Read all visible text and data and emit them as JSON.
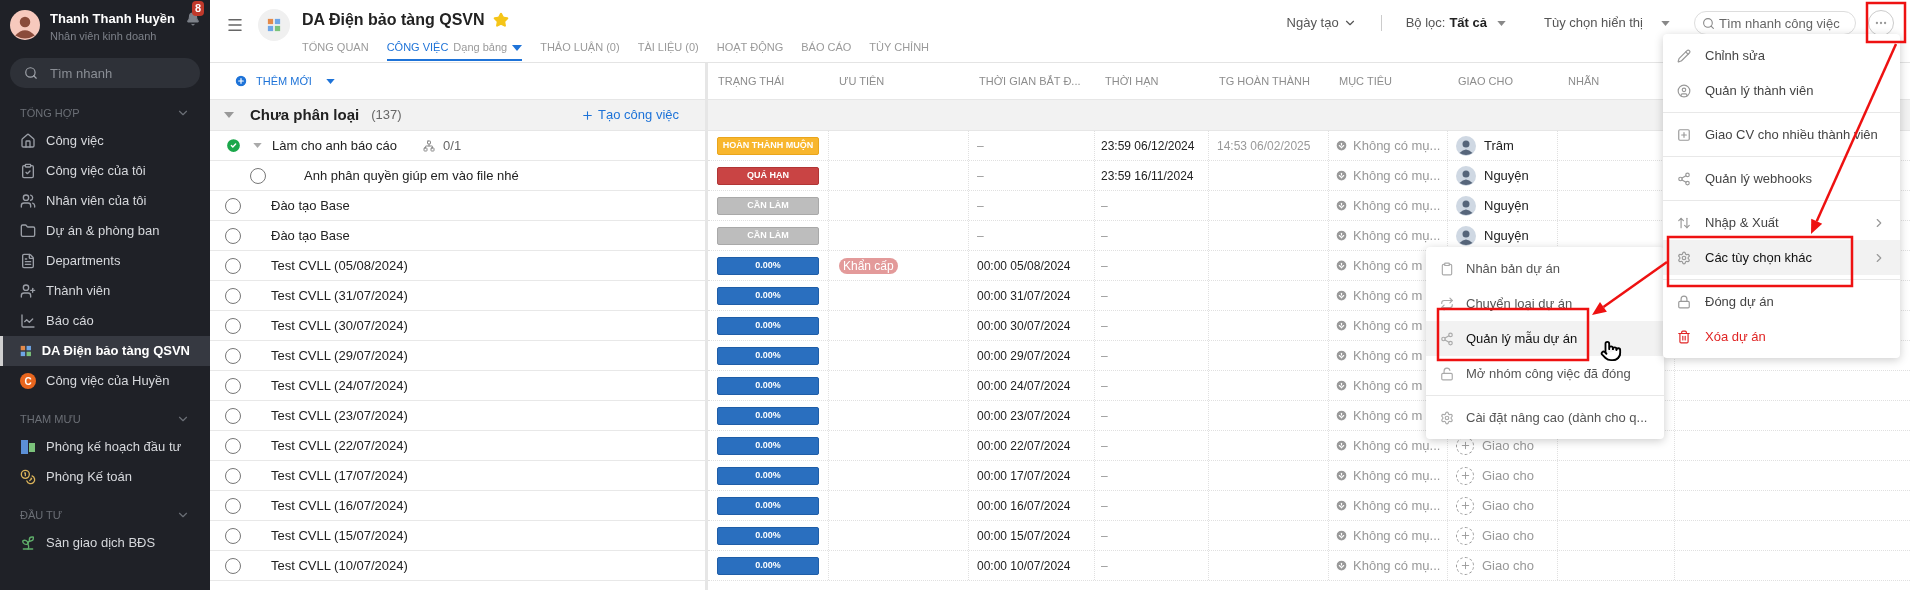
{
  "sidebar": {
    "user": {
      "name": "Thanh Thanh Huyền",
      "role": "Nhân viên kinh doanh",
      "notifications": "8"
    },
    "search": {
      "placeholder": "Tìm nhanh"
    },
    "sections": [
      {
        "title": "TỔNG HỢP",
        "expanded": true,
        "items": [
          {
            "label": "Công việc",
            "selected": false
          },
          {
            "label": "Công việc của tôi",
            "selected": false
          },
          {
            "label": "Nhân viên của tôi",
            "selected": false
          },
          {
            "label": "Dự án & phòng ban",
            "selected": false
          },
          {
            "label": "Departments",
            "selected": false
          },
          {
            "label": "Thành viên",
            "selected": false
          },
          {
            "label": "Báo cáo",
            "selected": false
          },
          {
            "label": "DA Điện bảo tàng QSVN",
            "selected": true
          },
          {
            "label": "Công việc của Huyền",
            "badge": "C",
            "selected": false
          }
        ]
      },
      {
        "title": "THAM MƯU",
        "expanded": true,
        "items": [
          {
            "label": "Phòng kế hoạch đầu tư",
            "selected": false
          },
          {
            "label": "Phòng Kế toán",
            "selected": false
          }
        ]
      },
      {
        "title": "ĐẦU TƯ",
        "expanded": true,
        "items": [
          {
            "label": "Sàn giao dịch BĐS",
            "selected": false
          }
        ]
      }
    ]
  },
  "header": {
    "title": "DA Điện bảo tàng QSVN",
    "starred": true,
    "tabs": [
      {
        "label": "TỔNG QUAN",
        "selected": false
      },
      {
        "label": "CÔNG VIỆC",
        "view": "Dạng bảng",
        "selected": true
      },
      {
        "label": "THẢO LUẬN (0)",
        "selected": false
      },
      {
        "label": "TÀI LIỆU (0)",
        "selected": false
      },
      {
        "label": "HOẠT ĐỘNG",
        "selected": false
      },
      {
        "label": "BÁO CÁO",
        "selected": false
      },
      {
        "label": "TÙY CHỈNH",
        "selected": false
      }
    ],
    "toolbar": {
      "sort": "Ngày tạo",
      "filter_label": "Bộ lọc:",
      "filter_value": "Tất cả",
      "display": "Tùy chọn hiển thị",
      "search": {
        "placeholder": "Tìm nhanh công việc"
      }
    }
  },
  "table": {
    "add_button": "THÊM MỚI",
    "columns": [
      "TRẠNG THÁI",
      "ƯU TIÊN",
      "THỜI GIAN BẮT Đ...",
      "THỜI HẠN",
      "TG HOÀN THÀNH",
      "MỤC TIÊU",
      "GIAO CHO",
      "NHÃN"
    ],
    "group": {
      "name": "Chưa phân loại",
      "count": "(137)",
      "expanded": true,
      "create": "Tạo công việc"
    },
    "rows": [
      {
        "name": "Làm cho anh báo cáo",
        "done": true,
        "expanded": true,
        "subtasks": "0/1",
        "status": {
          "kind": "late",
          "label": "HOÀN THÀNH MUỘN"
        },
        "start": "–",
        "deadline": "23:59 06/12/2024",
        "completed": "14:53 06/02/2025",
        "goal": "Không có mụ...",
        "assignee": {
          "kind": "user",
          "name": "Trâm"
        },
        "children": [
          {
            "name": "Anh phân quyền giúp em vào file nhé",
            "done": false,
            "status": {
              "kind": "overdue",
              "label": "QUÁ HẠN"
            },
            "start": "–",
            "deadline": "23:59 16/11/2024",
            "goal": "Không có mụ...",
            "assignee": {
              "kind": "user",
              "name": "Nguyện"
            }
          }
        ]
      },
      {
        "name": "Đào tạo Base",
        "done": false,
        "status": {
          "kind": "todo",
          "label": "CẦN LÀM"
        },
        "start": "–",
        "deadline": "–",
        "goal": "Không có mụ...",
        "assignee": {
          "kind": "user",
          "name": "Nguyện"
        }
      },
      {
        "name": "Đào tạo Base",
        "done": false,
        "status": {
          "kind": "todo",
          "label": "CẦN LÀM"
        },
        "start": "–",
        "deadline": "–",
        "goal": "Không có mụ...",
        "assignee": {
          "kind": "user",
          "name": "Nguyện"
        }
      },
      {
        "name": "Test CVLL (05/08/2024)",
        "done": false,
        "status": {
          "kind": "progress",
          "label": "0.00%"
        },
        "priority": "Khẩn cấp",
        "start": "00:00 05/08/2024",
        "deadline": "–",
        "goal": "Không có m"
      },
      {
        "name": "Test CVLL (31/07/2024)",
        "done": false,
        "status": {
          "kind": "progress",
          "label": "0.00%"
        },
        "start": "00:00 31/07/2024",
        "deadline": "–",
        "goal": "Không có m"
      },
      {
        "name": "Test CVLL (30/07/2024)",
        "done": false,
        "status": {
          "kind": "progress",
          "label": "0.00%"
        },
        "start": "00:00 30/07/2024",
        "deadline": "–",
        "goal": "Không có m"
      },
      {
        "name": "Test CVLL (29/07/2024)",
        "done": false,
        "status": {
          "kind": "progress",
          "label": "0.00%"
        },
        "start": "00:00 29/07/2024",
        "deadline": "–",
        "goal": "Không có m"
      },
      {
        "name": "Test CVLL (24/07/2024)",
        "done": false,
        "status": {
          "kind": "progress",
          "label": "0.00%"
        },
        "start": "00:00 24/07/2024",
        "deadline": "–",
        "goal": "Không có m"
      },
      {
        "name": "Test CVLL (23/07/2024)",
        "done": false,
        "status": {
          "kind": "progress",
          "label": "0.00%"
        },
        "start": "00:00 23/07/2024",
        "deadline": "–",
        "goal": "Không có m"
      },
      {
        "name": "Test CVLL (22/07/2024)",
        "done": false,
        "status": {
          "kind": "progress",
          "label": "0.00%"
        },
        "start": "00:00 22/07/2024",
        "deadline": "–",
        "goal": "Không có mụ...",
        "assignee": {
          "kind": "unassigned",
          "name": "Giao cho"
        }
      },
      {
        "name": "Test CVLL (17/07/2024)",
        "done": false,
        "status": {
          "kind": "progress",
          "label": "0.00%"
        },
        "start": "00:00 17/07/2024",
        "deadline": "–",
        "goal": "Không có mụ...",
        "assignee": {
          "kind": "unassigned",
          "name": "Giao cho"
        }
      },
      {
        "name": "Test CVLL (16/07/2024)",
        "done": false,
        "status": {
          "kind": "progress",
          "label": "0.00%"
        },
        "start": "00:00 16/07/2024",
        "deadline": "–",
        "goal": "Không có mụ...",
        "assignee": {
          "kind": "unassigned",
          "name": "Giao cho"
        }
      },
      {
        "name": "Test CVLL (15/07/2024)",
        "done": false,
        "status": {
          "kind": "progress",
          "label": "0.00%"
        },
        "start": "00:00 15/07/2024",
        "deadline": "–",
        "goal": "Không có mụ...",
        "assignee": {
          "kind": "unassigned",
          "name": "Giao cho"
        }
      },
      {
        "name": "Test CVLL (10/07/2024)",
        "done": false,
        "status": {
          "kind": "progress",
          "label": "0.00%"
        },
        "start": "00:00 10/07/2024",
        "deadline": "–",
        "goal": "Không có mụ...",
        "assignee": {
          "kind": "unassigned",
          "name": "Giao cho"
        }
      }
    ]
  },
  "more_menu": {
    "groups": [
      [
        {
          "label": "Chỉnh sửa",
          "kind": "item",
          "selected": false
        },
        {
          "label": "Quản lý thành viên",
          "kind": "item",
          "selected": false
        }
      ],
      [
        {
          "label": "Giao CV cho nhiều thành viên",
          "kind": "item",
          "selected": false
        }
      ],
      [
        {
          "label": "Quản lý webhooks",
          "kind": "item",
          "selected": false
        }
      ],
      [
        {
          "label": "Nhập & Xuất",
          "kind": "submenu",
          "selected": false
        },
        {
          "label": "Các tùy chọn khác",
          "kind": "submenu",
          "selected": true
        }
      ],
      [
        {
          "label": "Đóng dự án",
          "kind": "item",
          "selected": false
        },
        {
          "label": "Xóa dự án",
          "kind": "danger",
          "selected": false
        }
      ]
    ]
  },
  "sub_menu": {
    "groups": [
      [
        {
          "label": "Nhân bản dự án",
          "selected": false
        },
        {
          "label": "Chuyển loại dự án",
          "selected": false
        },
        {
          "label": "Quản lý mẫu dự án",
          "selected": true
        },
        {
          "label": "Mở nhóm công việc đã đóng",
          "selected": false
        }
      ],
      [
        {
          "label": "Cài đặt nâng cao (dành cho q...",
          "selected": false
        }
      ]
    ]
  }
}
